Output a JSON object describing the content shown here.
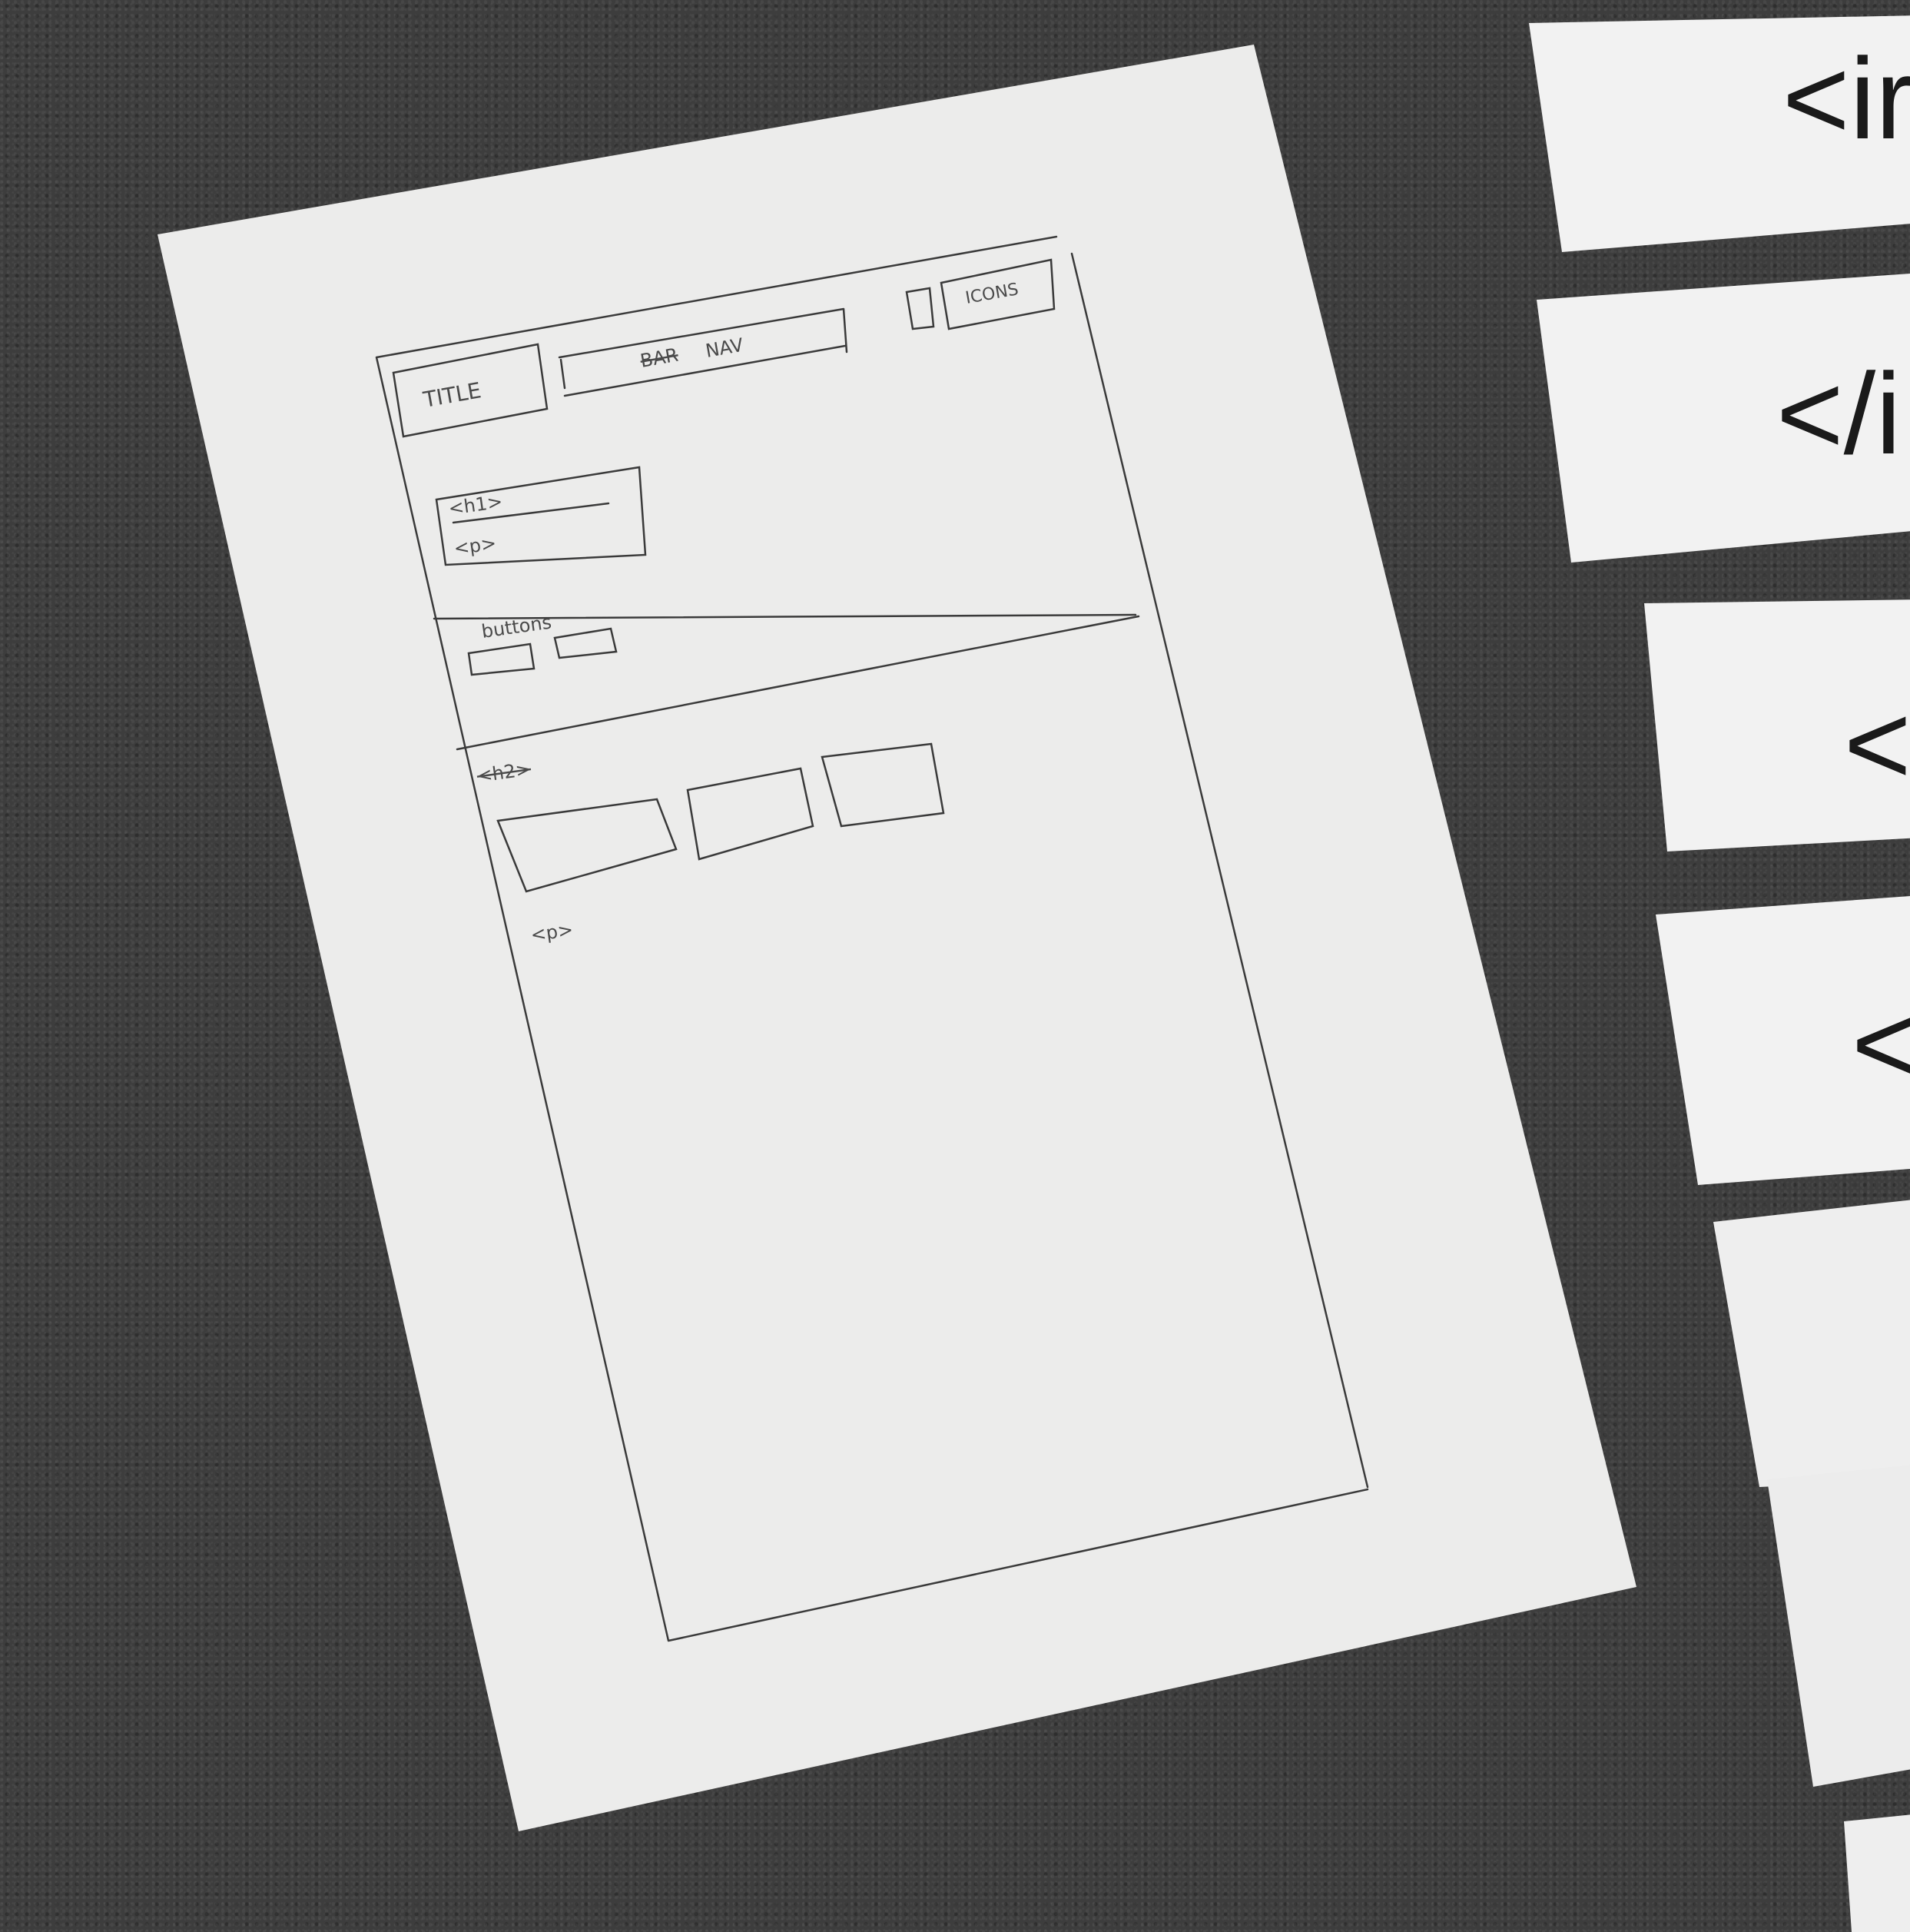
{
  "sketch": {
    "title_box_label": "TITLE",
    "nav_struck_word": "BAR",
    "nav_label": "NAV",
    "icons_label": "ICONS",
    "heading_label": "<h1>",
    "paragraph_label": "<p>",
    "buttons_label": "buttons",
    "section_heading_label": "<h2>",
    "bottom_paragraph_label": "<p>"
  },
  "cards": [
    {
      "text": "<ir"
    },
    {
      "text": "</i"
    },
    {
      "text": "<"
    },
    {
      "text": "<"
    }
  ]
}
